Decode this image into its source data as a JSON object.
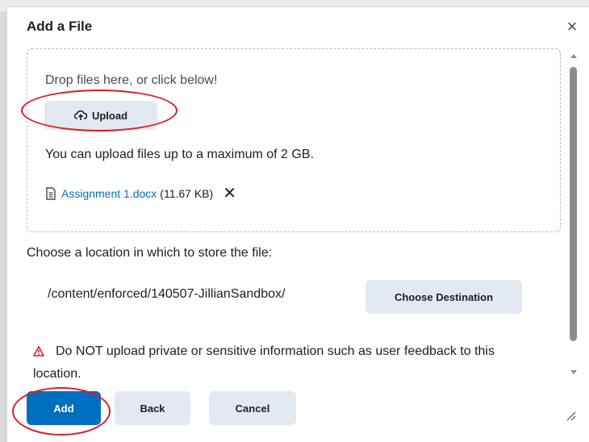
{
  "dialog": {
    "title": "Add a File",
    "close_label": "×"
  },
  "dropzone": {
    "drop_text": "Drop files here, or click below!",
    "upload_label": "Upload",
    "limit_text": "You can upload files up to a maximum of 2 GB.",
    "file": {
      "name": "Assignment 1.docx",
      "size": "(11.67 KB)",
      "remove_label": "✕"
    }
  },
  "location": {
    "label": "Choose a location in which to store the file:",
    "path": "/content/enforced/140507-JillianSandbox/",
    "choose_label": "Choose Destination"
  },
  "warning": {
    "text": "Do NOT upload private or sensitive information such as user feedback to this location."
  },
  "footer": {
    "add_label": "Add",
    "back_label": "Back",
    "cancel_label": "Cancel"
  },
  "colors": {
    "primary": "#006fbf",
    "secondary_button": "#e3e9f1",
    "annotation": "#e01b24",
    "warning_icon": "#cd2026"
  },
  "icons": [
    "close-icon",
    "upload-cloud-icon",
    "document-icon",
    "remove-icon",
    "warning-icon",
    "resize-handle-icon"
  ]
}
